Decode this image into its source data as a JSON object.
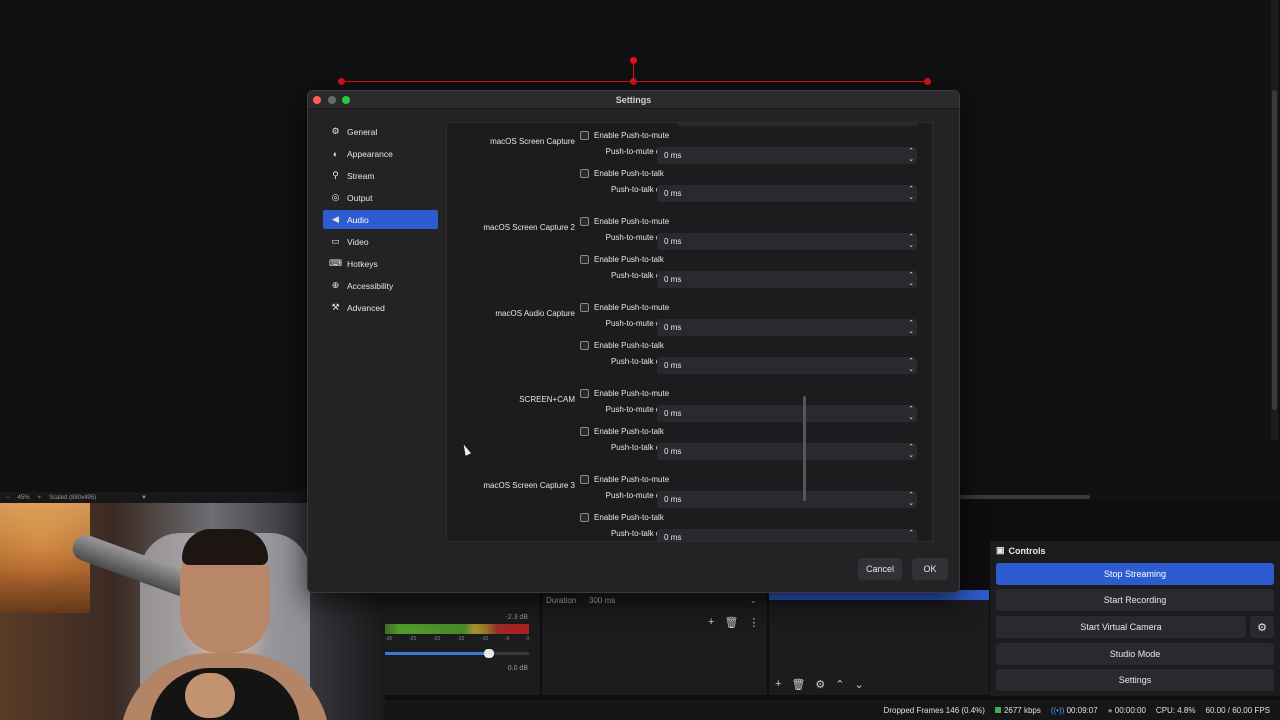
{
  "zoom_bar": {
    "zoom": "45%",
    "scaled": "Scaled (880x495)"
  },
  "dialog": {
    "title": "Settings",
    "nav": [
      {
        "label": "General",
        "icon": "gear-icon",
        "glyph": "⚙"
      },
      {
        "label": "Appearance",
        "icon": "palette-icon",
        "glyph": "◐"
      },
      {
        "label": "Stream",
        "icon": "antenna-icon",
        "glyph": "⚲"
      },
      {
        "label": "Output",
        "icon": "output-icon",
        "glyph": "◎"
      },
      {
        "label": "Audio",
        "icon": "speaker-icon",
        "glyph": "◀",
        "active": true
      },
      {
        "label": "Video",
        "icon": "monitor-icon",
        "glyph": "▭"
      },
      {
        "label": "Hotkeys",
        "icon": "keyboard-icon",
        "glyph": "⌨"
      },
      {
        "label": "Accessibility",
        "icon": "accessibility-icon",
        "glyph": "⊕"
      },
      {
        "label": "Advanced",
        "icon": "wrench-icon",
        "glyph": "⚒"
      }
    ],
    "sources": [
      {
        "name": "macOS Screen Capture",
        "mute_check": "Enable Push-to-mute",
        "mute_delay_label": "Push-to-mute delay",
        "mute_delay": "0 ms",
        "talk_check": "Enable Push-to-talk",
        "talk_delay_label": "Push-to-talk delay",
        "talk_delay": "0 ms"
      },
      {
        "name": "macOS Screen Capture 2",
        "mute_check": "Enable Push-to-mute",
        "mute_delay_label": "Push-to-mute delay",
        "mute_delay": "0 ms",
        "talk_check": "Enable Push-to-talk",
        "talk_delay_label": "Push-to-talk delay",
        "talk_delay": "0 ms"
      },
      {
        "name": "macOS Audio Capture",
        "mute_check": "Enable Push-to-mute",
        "mute_delay_label": "Push-to-mute delay",
        "mute_delay": "0 ms",
        "talk_check": "Enable Push-to-talk",
        "talk_delay_label": "Push-to-talk delay",
        "talk_delay": "0 ms"
      },
      {
        "name": "SCREEN+CAM",
        "mute_check": "Enable Push-to-mute",
        "mute_delay_label": "Push-to-mute delay",
        "mute_delay": "0 ms",
        "talk_check": "Enable Push-to-talk",
        "talk_delay_label": "Push-to-talk delay",
        "talk_delay": "0 ms"
      },
      {
        "name": "macOS Screen Capture 3",
        "mute_check": "Enable Push-to-mute",
        "mute_delay_label": "Push-to-mute delay",
        "mute_delay": "0 ms",
        "talk_check": "Enable Push-to-talk",
        "talk_delay_label": "Push-to-talk delay",
        "talk_delay": "0 ms"
      }
    ],
    "cancel_label": "Cancel",
    "ok_label": "OK"
  },
  "mixer": {
    "db_top": "-2.3 dB",
    "db_bottom": "0.0 dB",
    "scale": [
      "-30",
      "-25",
      "-20",
      "-15",
      "-10",
      "-5",
      "0"
    ],
    "volume": 0.72
  },
  "transitions": {
    "duration_label": "Duration",
    "duration_value": "300 ms"
  },
  "controls": {
    "title": "Controls",
    "stop_streaming": "Stop Streaming",
    "start_recording": "Start Recording",
    "start_virtual_camera": "Start Virtual Camera",
    "studio_mode": "Studio Mode",
    "settings": "Settings"
  },
  "status": {
    "dropped": "Dropped Frames 146 (0.4%)",
    "bitrate": "2677 kbps",
    "stream_time": "00:09:07",
    "rec_time": "00:00:00",
    "cpu": "CPU: 4.8%",
    "fps": "60.00 / 60.00 FPS"
  },
  "colors": {
    "accent": "#2d5bd0",
    "record_red": "#e0101a",
    "live_green": "#3bb34a"
  }
}
